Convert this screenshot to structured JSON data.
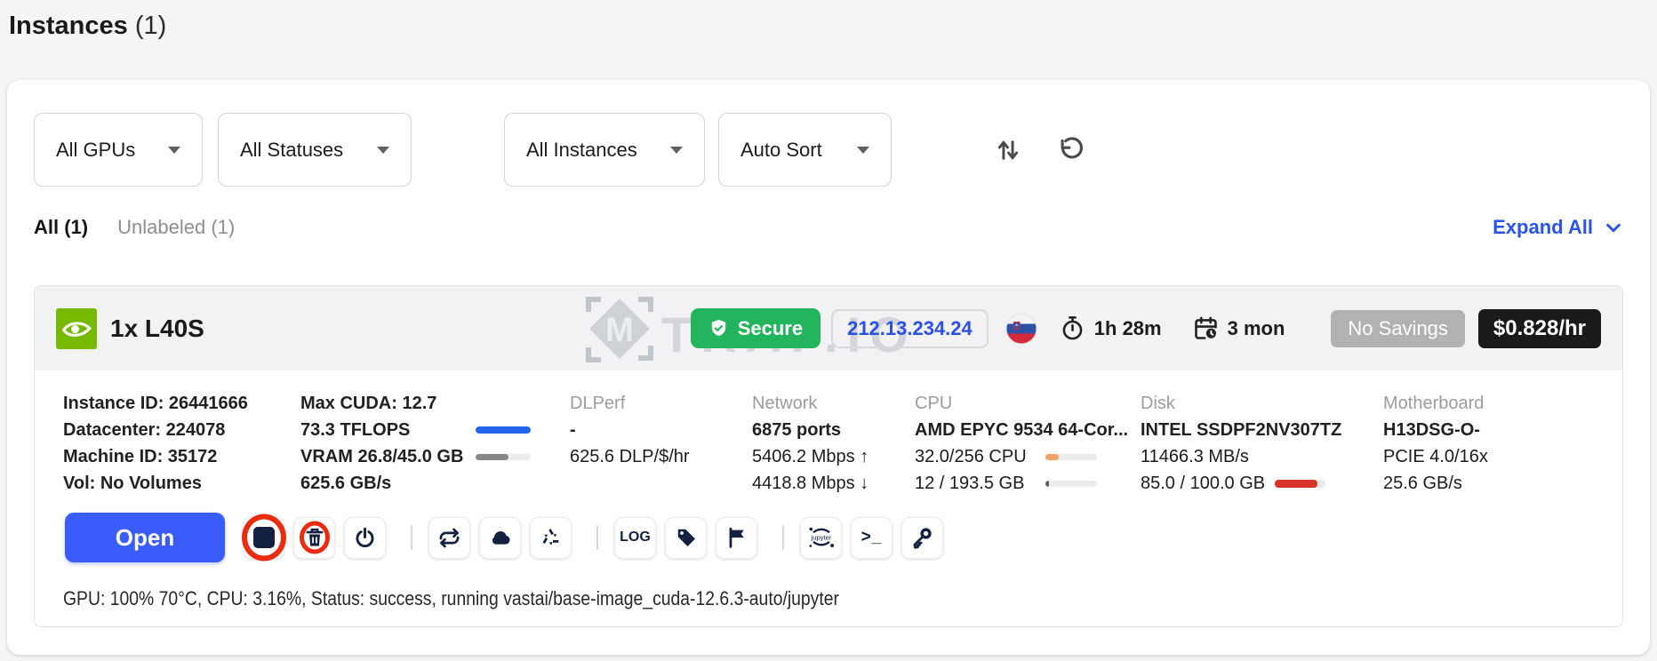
{
  "page": {
    "title": "Instances",
    "count": "(1)"
  },
  "filters": {
    "dropdowns": [
      {
        "id": "gpu",
        "label": "All GPUs"
      },
      {
        "id": "status",
        "label": "All Statuses"
      },
      {
        "id": "instance",
        "label": "All Instances"
      },
      {
        "id": "sort",
        "label": "Auto Sort"
      }
    ]
  },
  "tabs": {
    "all": "All (1)",
    "unlabeled": "Unlabeled (1)",
    "expand_all": "Expand All"
  },
  "watermark": {
    "logo_letter": "M",
    "text": "TRAF.IO"
  },
  "instance": {
    "gpu_name": "1x L40S",
    "secure_label": "Secure",
    "ip_address": "212.13.234.24",
    "country": "slovenia",
    "uptime": "1h 28m",
    "rental_period": "3 mon",
    "savings_label": "No Savings",
    "price_per_hour": "$0.828/hr",
    "details": {
      "identity": {
        "lines": [
          "Instance ID: 26441666",
          "Datacenter: 224078",
          "Machine ID: 35172",
          "Vol: No Volumes"
        ]
      },
      "gpu": {
        "lines": [
          "Max CUDA: 12.7",
          "73.3 TFLOPS",
          "VRAM 26.8/45.0 GB",
          "625.6 GB/s"
        ],
        "util_pct": 100,
        "vram_pct": 60
      },
      "dlperf": {
        "header": "DLPerf",
        "value": "-",
        "per_dollar": "625.6 DLP/$/hr"
      },
      "network": {
        "header": "Network",
        "ports": "6875 ports",
        "upload": "5406.2 Mbps ↑",
        "download": "4418.8 Mbps ↓"
      },
      "cpu": {
        "header": "CPU",
        "name": "AMD EPYC 9534 64-Cor...",
        "cores": "32.0/256 CPU",
        "memory": "12 / 193.5 GB",
        "cores_pct": 25,
        "memory_pct": 7
      },
      "disk": {
        "header": "Disk",
        "name": "INTEL SSDPF2NV307TZ",
        "speed": "11466.3 MB/s",
        "usage": "85.0 / 100.0 GB",
        "usage_pct": 85
      },
      "motherboard": {
        "header": "Motherboard",
        "name": "H13DSG-O-",
        "pcie": "PCIE 4.0/16x",
        "bandwidth": "25.6 GB/s"
      }
    },
    "actions": {
      "open": "Open",
      "log": "LOG",
      "terminal": ">_"
    },
    "status_line": "GPU: 100% 70°C, CPU: 3.16%, Status: success, running vastai/base-image_cuda-12.6.3-auto/jupyter"
  },
  "colors": {
    "accent_blue": "#2a53e8",
    "open_button_blue": "#3a5cfa",
    "ip_blue": "#2b50e6",
    "secure_green": "#23b45e",
    "icon_navy": "#13203f",
    "price_badge_bg": "#1a1a1a",
    "no_savings_bg": "#b2b2b4",
    "annotation_red": "#ea2b10",
    "gpu_bar_blue": "#2563eb",
    "vram_bar_gray": "#87878a",
    "cpu_bar_orange": "#f2a266",
    "disk_bar_red": "#d63426",
    "nvidia_green": "#76b900"
  }
}
